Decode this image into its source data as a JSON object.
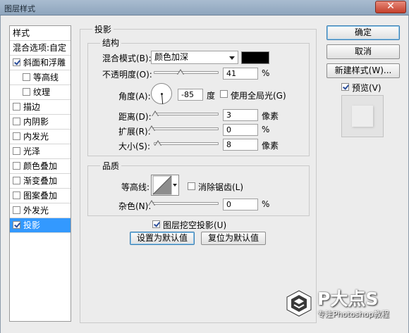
{
  "window": {
    "title": "图层样式",
    "close_glyph": "✕"
  },
  "left_panel": {
    "header": "样式",
    "blend_options": "混合选项:自定",
    "items": [
      {
        "label": "斜面和浮雕",
        "checked": true
      },
      {
        "label": "等高线",
        "checked": false
      },
      {
        "label": "纹理",
        "checked": false
      },
      {
        "label": "描边",
        "checked": false
      },
      {
        "label": "内阴影",
        "checked": false
      },
      {
        "label": "内发光",
        "checked": false
      },
      {
        "label": "光泽",
        "checked": false
      },
      {
        "label": "颜色叠加",
        "checked": false
      },
      {
        "label": "渐变叠加",
        "checked": false
      },
      {
        "label": "图案叠加",
        "checked": false
      },
      {
        "label": "外发光",
        "checked": false
      },
      {
        "label": "投影",
        "checked": true
      }
    ]
  },
  "drop_shadow": {
    "title": "投影",
    "structure": {
      "title": "结构",
      "blend_mode_label": "混合模式(B):",
      "blend_mode_value": "颜色加深",
      "shadow_color": "#000000",
      "opacity_label": "不透明度(O):",
      "opacity_value": "41",
      "opacity_fraction": 0.41,
      "percent": "%",
      "angle_label": "角度(A):",
      "angle_value": "-85",
      "angle_unit": "度",
      "global_light_label": "使用全局光(G)",
      "global_light_checked": false,
      "distance_label": "距离(D):",
      "distance_value": "3",
      "pixels_unit": "像素",
      "spread_label": "扩展(R):",
      "spread_value": "0",
      "size_label": "大小(S):",
      "size_value": "8"
    },
    "quality": {
      "title": "品质",
      "contour_label": "等高线:",
      "anti_alias_label": "消除锯齿(L)",
      "anti_alias_checked": false,
      "noise_label": "杂色(N):",
      "noise_value": "0",
      "percent": "%"
    },
    "layer_knocks_out_label": "图层挖空投影(U)",
    "layer_knocks_out_checked": true,
    "make_default": "设置为默认值",
    "reset_default": "复位为默认值"
  },
  "buttons": {
    "ok": "确定",
    "cancel": "取消",
    "new_style": "新建样式(W)...",
    "preview_label": "预览(V)",
    "preview_checked": true
  },
  "watermark": {
    "title": "P大点S",
    "subtitle": "专注Photoshop教程"
  }
}
